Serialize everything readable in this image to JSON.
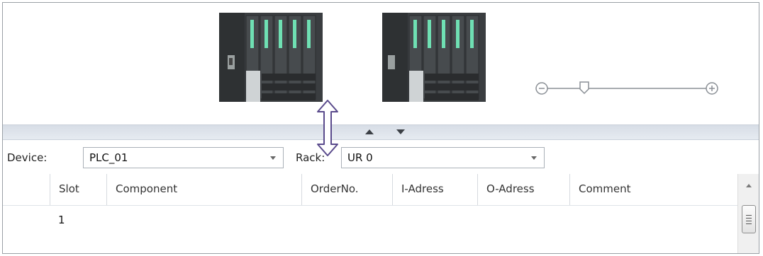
{
  "toolbar": {
    "device_label": "Device:",
    "device_value": "PLC_01",
    "rack_label": "Rack:",
    "rack_value": "UR 0"
  },
  "table": {
    "columns": [
      "",
      "Slot",
      "Component",
      "OrderNo.",
      "I-Adress",
      "O-Adress",
      "Comment"
    ],
    "rows": [
      {
        "slot": "1",
        "component": "",
        "orderno": "",
        "iaddr": "",
        "oaddr": "",
        "comment": ""
      }
    ]
  },
  "icons": [
    "zoom-out-icon",
    "zoom-in-icon",
    "zoom-slider-thumb",
    "splitter-up-arrow",
    "splitter-down-arrow",
    "resize-cursor-icon",
    "plc-rack-image"
  ],
  "colors": {
    "splitter": "#dfe4ea",
    "module": "#3d4143",
    "led": "#5fd3a6"
  }
}
